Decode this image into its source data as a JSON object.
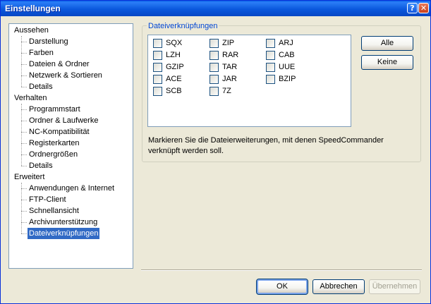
{
  "window": {
    "title": "Einstellungen",
    "help_glyph": "?",
    "close_glyph": "✕"
  },
  "tree": {
    "groups": [
      {
        "label": "Aussehen",
        "items": [
          "Darstellung",
          "Farben",
          "Dateien & Ordner",
          "Netzwerk & Sortieren",
          "Details"
        ]
      },
      {
        "label": "Verhalten",
        "items": [
          "Programmstart",
          "Ordner & Laufwerke",
          "NC-Kompatibilität",
          "Registerkarten",
          "Ordnergrößen",
          "Details"
        ]
      },
      {
        "label": "Erweitert",
        "items": [
          "Anwendungen & Internet",
          "FTP-Client",
          "Schnellansicht",
          "Archivunterstützung",
          "Dateiverknüpfungen"
        ]
      }
    ],
    "selected": "Dateiverknüpfungen"
  },
  "panel": {
    "group_title": "Dateiverknüpfungen",
    "extensions": [
      [
        "SQX",
        "ZIP",
        "ARJ"
      ],
      [
        "LZH",
        "RAR",
        "CAB"
      ],
      [
        "GZIP",
        "TAR",
        "UUE"
      ],
      [
        "ACE",
        "JAR",
        "BZIP"
      ],
      [
        "SCB",
        "7Z"
      ]
    ],
    "all_checked": false,
    "buttons": {
      "all": "Alle",
      "none": "Keine"
    },
    "description": "Markieren Sie die Dateierweiterungen, mit denen SpeedCommander verknüpft werden soll."
  },
  "footer": {
    "ok": "OK",
    "cancel": "Abbrechen",
    "apply": "Übernehmen"
  }
}
